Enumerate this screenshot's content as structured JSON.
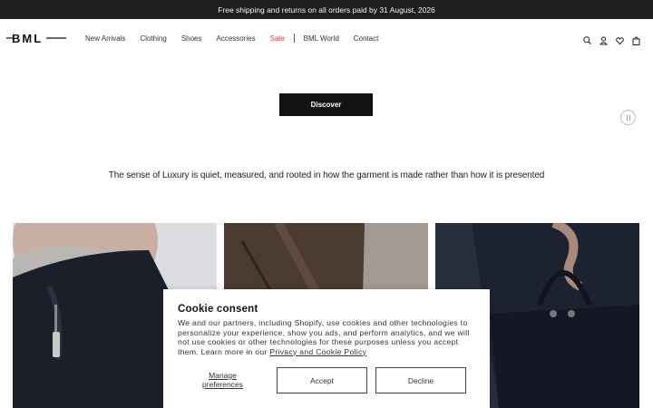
{
  "announcement": "Free shipping and returns on all orders paid by 31 August, 2026",
  "brand": {
    "logo_text": "BML"
  },
  "nav": {
    "items": [
      "New Arrivals",
      "Clothing",
      "Shoes",
      "Accessories"
    ],
    "sale": "Sale",
    "world": "BML World",
    "contact": "Contact"
  },
  "header_icons": [
    "search-icon",
    "account-icon",
    "wishlist-icon",
    "bag-icon"
  ],
  "hero": {
    "button_label": "Discover"
  },
  "tagline": "The sense of Luxury is quiet, measured, and rooted in how the garment is made rather than how it is presented",
  "cookie": {
    "title": "Cookie consent",
    "body": "We and our partners, including Shopify, use cookies and other technologies to personalize your experience, show you ads, and perform analytics, and we will not use cookies or other technologies for these purposes unless you accept them. Learn more in our ",
    "link": "Privacy and Cookie Policy",
    "manage": "Manage preferences",
    "accept": "Accept",
    "decline": "Decline"
  },
  "colors": {
    "announcement_bg": "#1f1d1d",
    "sale": "#e23b3b",
    "button_dark": "#121212"
  }
}
